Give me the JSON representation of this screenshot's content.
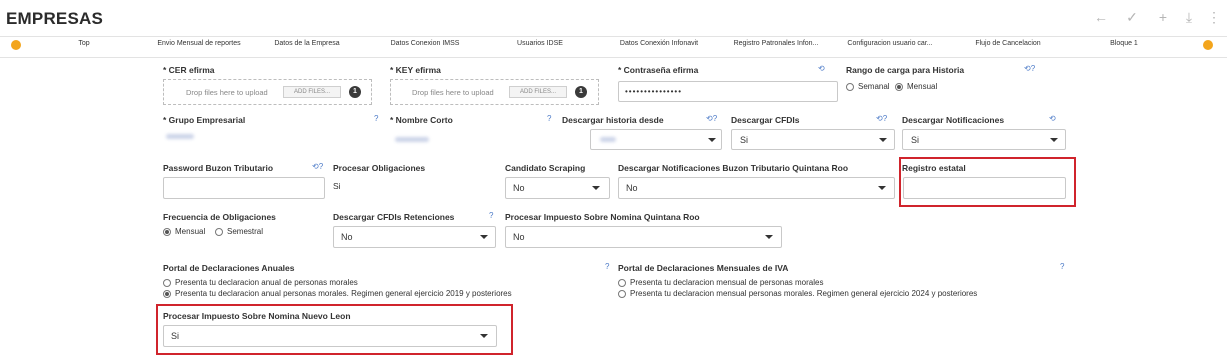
{
  "page": {
    "title": "EMPRESAS",
    "toolbar_icons": [
      "arrow-left-icon",
      "check-icon",
      "plus-icon",
      "download-icon",
      "more-vertical-icon"
    ],
    "toolbar_glyphs": [
      "←",
      "✓",
      "+",
      "⤓",
      "⋮"
    ]
  },
  "tabs": [
    "Top",
    "Envio Mensual de reportes",
    "Datos de la Empresa",
    "Datos Conexion IMSS",
    "Usuarios IDSE",
    "Datos Conexión Infonavit",
    "Registro Patronales Infon...",
    "Configuracion usuario car...",
    "Flujo de Cancelacion",
    "Bloque 1"
  ],
  "form": {
    "cer_label": "* CER efirma",
    "cer_drop_text": "Drop files here to upload",
    "cer_add_label": "ADD FILES...",
    "cer_count": "1",
    "key_label": "* KEY efirma",
    "key_drop_text": "Drop files here to upload",
    "key_add_label": "ADD FILES...",
    "key_count": "1",
    "password_label": "* Contraseña efirma",
    "password_value": "•••••••••••••••",
    "rango_label": "Rango de carga para Historia",
    "rango_options": [
      "Semanal",
      "Mensual"
    ],
    "rango_selected": "Mensual",
    "grupo_label": "* Grupo Empresarial",
    "nombre_label": "* Nombre Corto",
    "historia_label": "Descargar historia desde",
    "cfdis_label": "Descargar CFDIs",
    "cfdis_value": "Si",
    "notif_label": "Descargar Notificaciones",
    "notif_value": "Si",
    "buzon_pw_label": "Password Buzon Tributario",
    "obligaciones_label": "Procesar Obligaciones",
    "obligaciones_value": "Si",
    "scraping_label": "Candidato Scraping",
    "scraping_value": "No",
    "notif_qroo_label": "Descargar Notificaciones Buzon Tributario Quintana Roo",
    "notif_qroo_value": "No",
    "registro_label": "Registro estatal",
    "frecuencia_label": "Frecuencia de Obligaciones",
    "frecuencia_options": [
      "Mensual",
      "Semestral"
    ],
    "frecuencia_selected": "Mensual",
    "retenciones_label": "Descargar CFDIs Retenciones",
    "retenciones_value": "No",
    "isn_qroo_label": "Procesar Impuesto Sobre Nomina Quintana Roo",
    "isn_qroo_value": "No",
    "anuales_label": "Portal de Declaraciones Anuales",
    "anuales_options": [
      "Presenta tu declaracion anual de personas morales",
      "Presenta tu declaracion anual personas morales. Regimen general ejercicio 2019 y posteriores"
    ],
    "anuales_selected": 1,
    "iva_label": "Portal de Declaraciones Mensuales de IVA",
    "iva_options": [
      "Presenta tu declaracion mensual de personas morales",
      "Presenta tu declaracion mensual personas morales. Regimen general ejercicio 2024 y posteriores"
    ],
    "iva_selected": -1,
    "isn_nl_label": "Procesar Impuesto Sobre Nomina Nuevo Leon",
    "isn_nl_value": "Si"
  },
  "colors": {
    "accent": "#f3a51c",
    "highlight": "#d0242c",
    "help_icon": "#4a79c7"
  }
}
